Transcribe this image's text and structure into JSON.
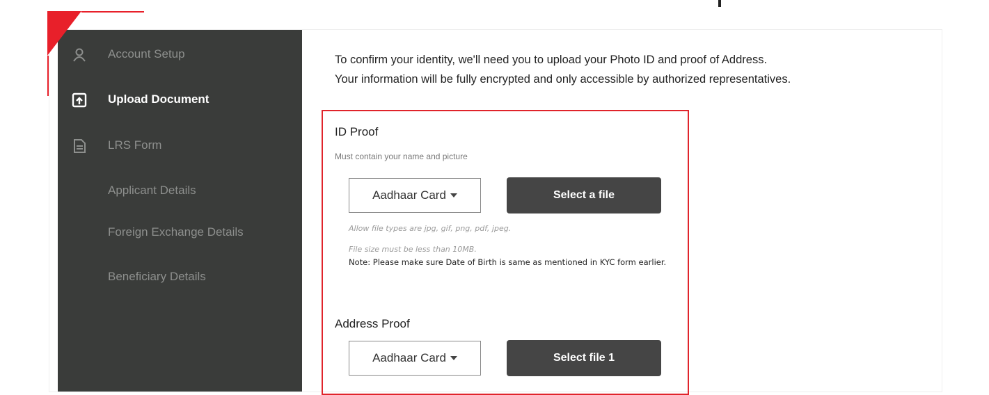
{
  "sidebar": {
    "items": [
      {
        "label": "Account Setup",
        "icon": "user-icon",
        "active": false
      },
      {
        "label": "Upload Document",
        "icon": "upload-file-icon",
        "active": true
      },
      {
        "label": "LRS Form",
        "icon": "document-icon",
        "active": false
      }
    ],
    "sub_items": [
      {
        "label": "Applicant Details"
      },
      {
        "label": "Foreign Exchange Details"
      },
      {
        "label": "Beneficiary Details"
      }
    ]
  },
  "intro": {
    "line1": "To confirm your identity, we'll need you to upload your Photo ID and proof of Address.",
    "line2": "Your information will be fully encrypted and only accessible by authorized representatives."
  },
  "id_proof": {
    "title": "ID Proof",
    "subtitle": "Must contain your name and picture",
    "selected": "Aadhaar Card",
    "button": "Select a file",
    "hint_types": "Allow file types are jpg, gif, png, pdf, jpeg.",
    "hint_size": "File size must be less than 10MB.",
    "note": "Note: Please make sure Date of Birth is same as mentioned in KYC form earlier."
  },
  "address_proof": {
    "title": "Address Proof",
    "selected": "Aadhaar Card",
    "button": "Select file 1"
  },
  "colors": {
    "accent": "#e0242b",
    "sidebar_bg": "#3a3c3a",
    "button_bg": "#454545"
  }
}
